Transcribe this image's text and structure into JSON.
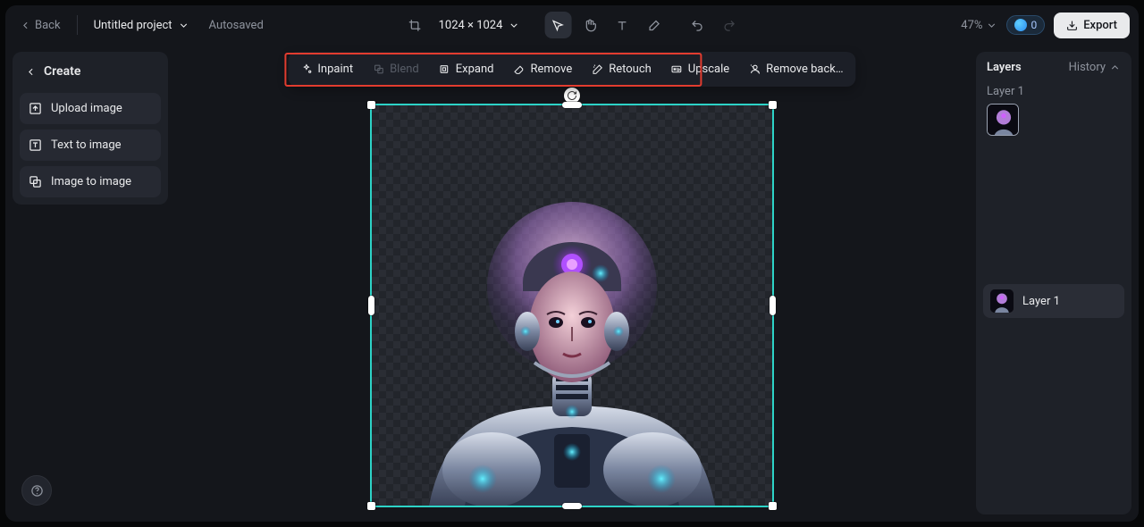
{
  "header": {
    "back": "Back",
    "project_name": "Untitled project",
    "autosaved": "Autosaved",
    "dimensions": "1024 × 1024",
    "zoom": "47%",
    "credits": "0",
    "export": "Export"
  },
  "create_panel": {
    "title": "Create",
    "upload": "Upload image",
    "text_to_image": "Text to image",
    "image_to_image": "Image to image"
  },
  "actions": {
    "inpaint": "Inpaint",
    "blend": "Blend",
    "expand": "Expand",
    "remove": "Remove",
    "retouch": "Retouch",
    "upscale": "Upscale",
    "remove_bg": "Remove back…"
  },
  "layers_panel": {
    "tab_layers": "Layers",
    "tab_history": "History",
    "layer_title": "Layer 1",
    "layer_item": "Layer 1"
  }
}
